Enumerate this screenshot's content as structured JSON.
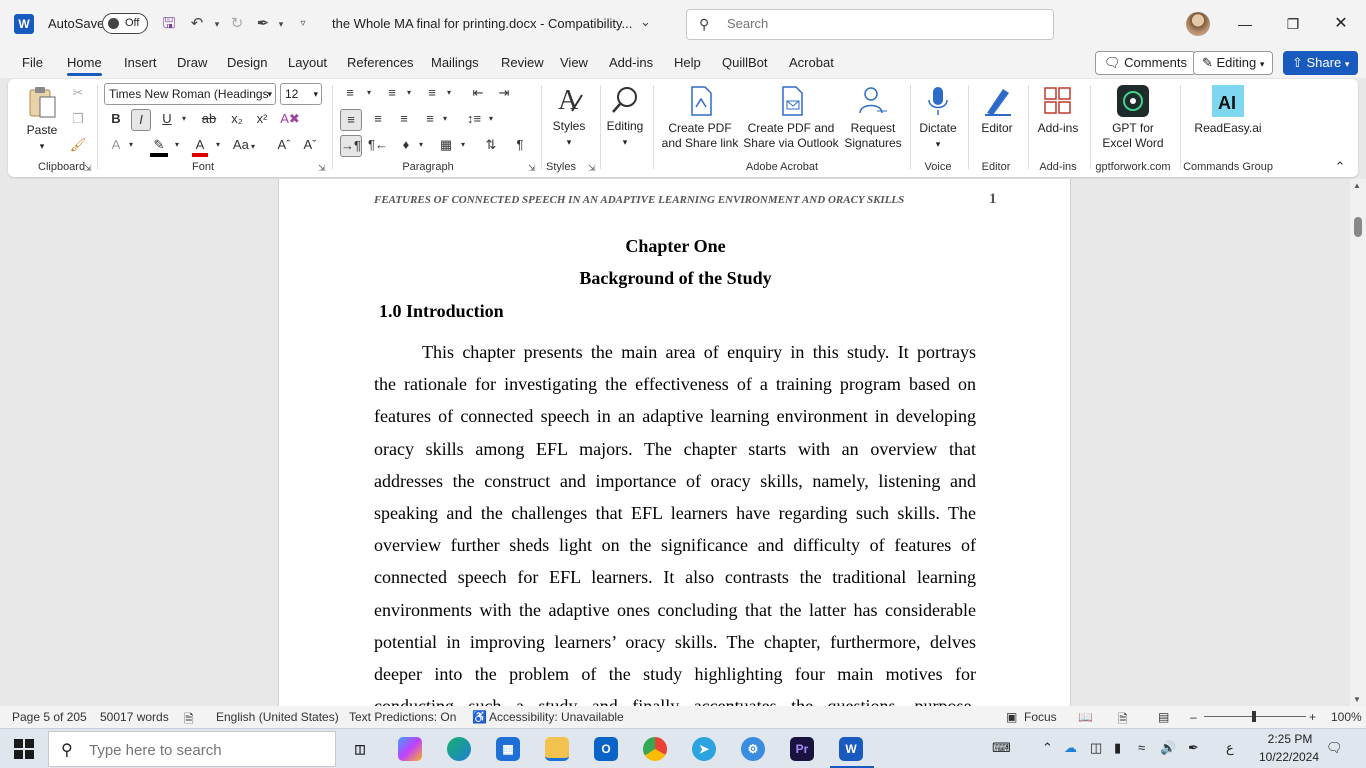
{
  "titlebar": {
    "app_logo": "W",
    "autosave_label": "AutoSave",
    "autosave_state": "Off",
    "doc_title": "the Whole MA final for printing.docx  -  Compatibility...",
    "search_placeholder": "Search"
  },
  "tabs": [
    "File",
    "Home",
    "Insert",
    "Draw",
    "Design",
    "Layout",
    "References",
    "Mailings",
    "Review",
    "View",
    "Add-ins",
    "Help",
    "QuillBot",
    "Acrobat"
  ],
  "active_tab": "Home",
  "header_buttons": {
    "comments": "Comments",
    "editing": "Editing",
    "share": "Share"
  },
  "ribbon": {
    "clipboard": {
      "paste": "Paste",
      "label": "Clipboard"
    },
    "font": {
      "name": "Times New Roman (Headings",
      "size": "12",
      "label": "Font"
    },
    "paragraph": {
      "label": "Paragraph"
    },
    "styles": {
      "styles": "Styles",
      "label": "Styles"
    },
    "editing": {
      "editing": "Editing"
    },
    "acrobat": {
      "create_pdf_1": "Create PDF",
      "create_pdf_2": "and Share link",
      "outlook_1": "Create PDF and",
      "outlook_2": "Share via Outlook",
      "sig_1": "Request",
      "sig_2": "Signatures",
      "label": "Adobe Acrobat"
    },
    "voice": {
      "dictate": "Dictate",
      "label": "Voice"
    },
    "editor": {
      "editor": "Editor",
      "label": "Editor"
    },
    "addins": {
      "addins": "Add-ins",
      "label": "Add-ins"
    },
    "gpt": {
      "line1": "GPT for",
      "line2": "Excel Word",
      "label": "gptforwork.com"
    },
    "readeasy": {
      "name": "ReadEasy.ai",
      "label": "Commands Group"
    }
  },
  "document": {
    "running_head": "FEATURES OF CONNECTED SPEECH IN AN ADAPTIVE LEARNING ENVIRONMENT AND ORACY SKILLS",
    "page_number": "1",
    "chapter_title": "Chapter One",
    "chapter_subtitle": "Background of the Study",
    "section_heading": "1.0 Introduction",
    "paragraph_lines": [
      "This chapter presents the main area of enquiry in this study. It portrays",
      "the rationale for investigating the effectiveness of a training program based on",
      "features of connected speech in an adaptive learning environment in developing",
      "oracy skills among EFL majors. The chapter starts with an overview that",
      "addresses the construct and importance of oracy skills, namely, listening and",
      "speaking and the challenges that EFL learners have regarding such skills. The",
      "overview further sheds light on the significance and difficulty of features of",
      "connected speech for EFL learners. It also contrasts the traditional learning",
      "environments with the adaptive ones concluding that the latter has considerable",
      "potential in improving learners’ oracy skills. The chapter, furthermore, delves",
      "deeper into the problem of the study highlighting four main motives for",
      "conducting such a study and finally accentuates the questions, purpose,"
    ]
  },
  "statusbar": {
    "page": "Page 5 of 205",
    "words": "50017 words",
    "language": "English (United States)",
    "predictions": "Text Predictions: On",
    "accessibility": "Accessibility: Unavailable",
    "focus": "Focus",
    "zoom": "100%"
  },
  "taskbar": {
    "search_placeholder": "Type here to search",
    "lang": "ع",
    "time": "2:25 PM",
    "date": "10/22/2024"
  },
  "colors": {
    "accent": "#185abd",
    "highlight": "#ffd600",
    "font_color": "#e00000"
  }
}
